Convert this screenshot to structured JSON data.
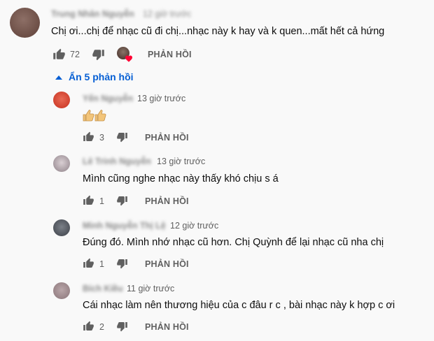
{
  "main_comment": {
    "author": "Trung Nhân Nguyễn",
    "time": "12 giờ trước",
    "text": "Chị ơi...chị để nhạc cũ đi chị...nhạc này k hay và k quen...mất hết cả hứng",
    "likes": "72",
    "reply_label": "PHẢN HỒI"
  },
  "replies_toggle": {
    "label": "Ẩn 5 phản hồi"
  },
  "replies": [
    {
      "author": "Yến Nguyễn",
      "time": "13 giờ trước",
      "text": "",
      "likes": "3",
      "reply_label": "PHẢN HỒI"
    },
    {
      "author": "Lê Trinh Nguyễn",
      "time": "13 giờ trước",
      "text": "Mình cũng nghe nhạc này thấy khó chịu s á",
      "likes": "1",
      "reply_label": "PHẢN HỒI"
    },
    {
      "author": "Minh Nguyễn Thị Lệ",
      "time": "12 giờ trước",
      "text": "Đúng đó. Mình nhớ nhạc cũ hơn. Chị Quỳnh để lại nhạc cũ nha chị",
      "likes": "1",
      "reply_label": "PHẢN HỒI"
    },
    {
      "author": "Bích Kiều",
      "time": "11 giờ trước",
      "text": "Cái nhạc làm nên thương hiệu của c đâu r c , bài nhạc này k hợp c ơi",
      "likes": "2",
      "reply_label": "PHẢN HỒI"
    }
  ],
  "colors": {
    "link_blue": "#065fd4",
    "heart_red": "#ff0033"
  },
  "icons": [
    "like-icon",
    "dislike-icon",
    "heart-icon",
    "chevron-up-icon",
    "thumbs-emoji-icon"
  ]
}
